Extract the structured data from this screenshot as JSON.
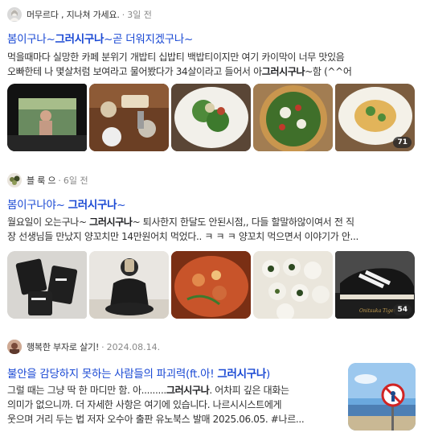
{
  "posts": [
    {
      "author": "머무르다 , 지나쳐 가세요.",
      "date": "3일 전",
      "title_parts": [
        "봄이구나~",
        "그러시구나",
        "~곧 더워지겠구나~"
      ],
      "desc_line1": "먹을때마다 실망한 카페 분위기 개밥티 십밥티 백밥티이지만 여기 카이막이 너무 맛있음",
      "desc_line2_pre": "오빠한테 나 몇살처럼 보여라고 물어봤다가 34살이라고 들어서 아",
      "desc_line2_bold": "그러시구나",
      "desc_line2_post": "~함 (^^어",
      "thumbs": [
        "movie-screen-photo",
        "cafe-table-photo",
        "salad-photo",
        "pizza-photo",
        "pasta-photo"
      ],
      "photo_count": "71"
    },
    {
      "author": "블 룩 으",
      "date": "6일 전",
      "title_parts": [
        "봄이구나야~ ",
        "그러시구나",
        "~"
      ],
      "desc_line1_pre": "월요일이 오는구나~ ",
      "desc_line1_bold": "그러시구나",
      "desc_line1_post": "~ 퇴사한지 한달도 안된시점,, 다들 할말하않이여서 전 직",
      "desc_line2": "장 선생님들 만났지 양꼬치만 14만원어치 먹었다.. ㅋ ㅋ ㅋ 양꼬치 먹으면서 이야기가 안...",
      "thumbs": [
        "gift-bags-photo",
        "mirror-selfie-photo",
        "stew-photo",
        "rice-balls-photo",
        "sneakers-photo"
      ],
      "photo_count": "54"
    },
    {
      "author": "행복한 부자로 살기!",
      "date": "2024.08.14.",
      "title_pre": "불안을 감당하지 못하는 사람들의 파괴력(ft.아! ",
      "title_bold": "그러시구나",
      "title_post": ")",
      "desc_line1_pre": "그럴 때는 그냥 딱 한 마디만 함. 아.........",
      "desc_line1_bold": "그러시구나",
      "desc_line1_post": ". 어차피 깊은 대화는",
      "desc_line2": "의미가 없으니까. 더 자세한 사항은 여기에 있습니다. 나르시시스트에게",
      "desc_line3": "웃으며 거리 두는 법 저자 오수아 출판 유노북스 발매 2025.06.05. #나르...",
      "thumb": "beach-sign-photo"
    }
  ],
  "sneaker_brand": "Onitsuka Tiger"
}
